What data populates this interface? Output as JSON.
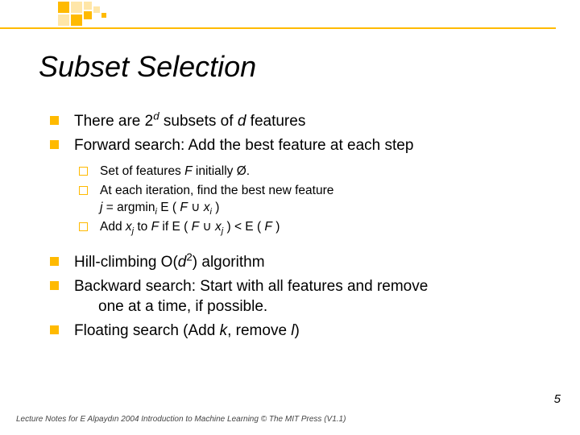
{
  "title": "Subset Selection",
  "bullets1": {
    "b0_pre": "There are 2",
    "b0_sup": "d",
    "b0_mid": " subsets of ",
    "b0_it": "d",
    "b0_post": " features",
    "b1": "Forward search: Add the best feature at each step"
  },
  "sub": {
    "s0_pre": "Set of features ",
    "s0_F": "F",
    "s0_post": " initially Ø.",
    "s1": "At each iteration, find the best new feature",
    "s1b_pre": "j",
    "s1b_eq": " = argmin",
    "s1b_sub": "i",
    "s1b_mid": " E ( ",
    "s1b_F": "F",
    "s1b_cup": " ∪ ",
    "s1b_x": "x",
    "s1b_xi": "i",
    "s1b_end": " )",
    "s2_pre": "Add ",
    "s2_x": "x",
    "s2_j": "j",
    "s2_mid": " to ",
    "s2_F": "F",
    "s2_if": "  if  E ( ",
    "s2_F2": "F",
    "s2_cup": " ∪ ",
    "s2_x2": "x",
    "s2_j2": "j",
    "s2_lt": " ) < E ( ",
    "s2_F3": "F",
    "s2_end": " )"
  },
  "bullets2": {
    "b2_pre": "Hill-climbing O(",
    "b2_d": "d",
    "b2_sup": "2",
    "b2_post": ") algorithm",
    "b3a": "Backward search: Start with all features and remove",
    "b3b": "one at a time, if possible.",
    "b4_pre": "Floating search (Add ",
    "b4_k": "k",
    "b4_mid": ", remove ",
    "b4_l": "l",
    "b4_post": ")"
  },
  "footer": "Lecture Notes for E Alpaydın 2004 Introduction to Machine Learning © The MIT Press (V1.1)",
  "pagenum": "5"
}
